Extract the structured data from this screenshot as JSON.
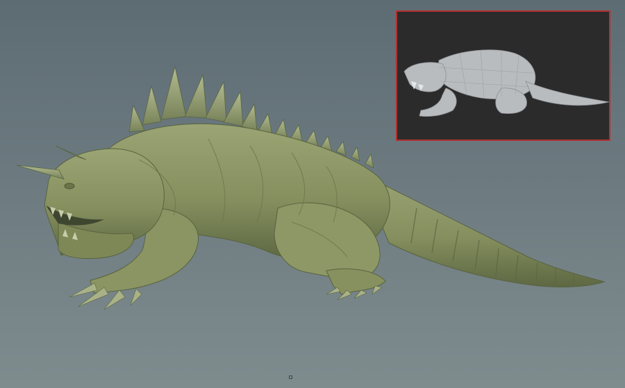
{
  "viewport": {
    "background_top": "#5d6b73",
    "background_bottom": "#7f8c8e"
  },
  "main_model": {
    "subject": "kaiju-creature-sculpt",
    "material_color": "#8a9466",
    "shadow_color": "#4f5a37",
    "highlight_color": "#aab487"
  },
  "inset": {
    "subject": "low-poly-base-mesh",
    "background": "#2b2b2c",
    "border_color": "#b4312f",
    "mesh_color": "#b9bcbe"
  }
}
